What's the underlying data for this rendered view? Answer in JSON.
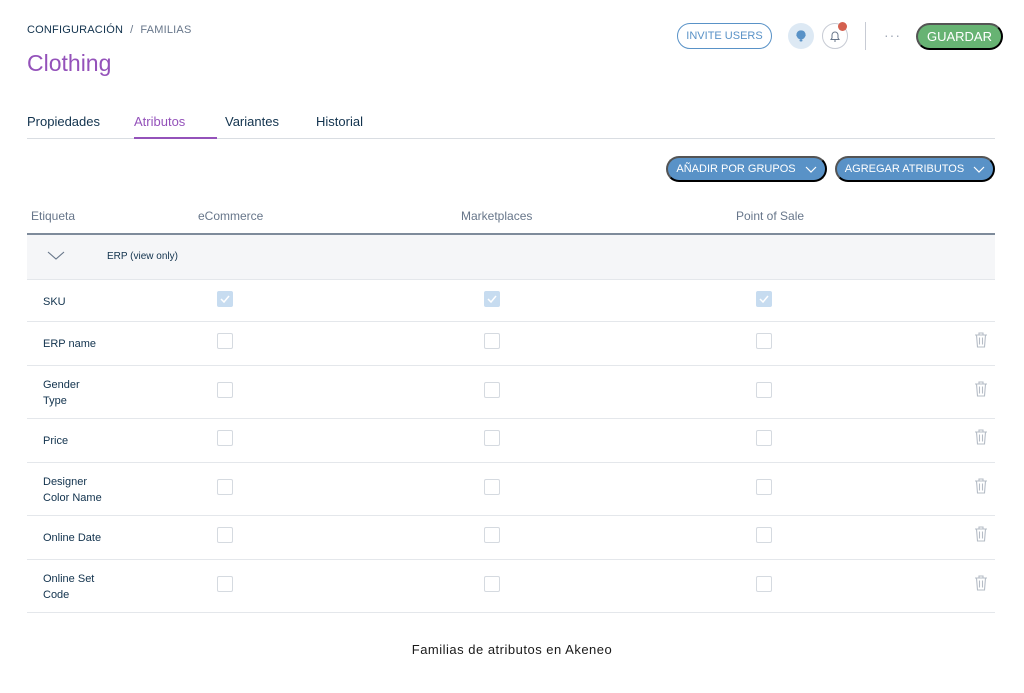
{
  "breadcrumb": {
    "level1": "CONFIGURACIÓN",
    "separator": "/",
    "level2": "FAMILIAS"
  },
  "page_title": "Clothing",
  "header": {
    "invite_label": "INVITE USERS",
    "save_label": "GUARDAR",
    "more_label": "···",
    "icons": {
      "help": "help-headset-icon",
      "notifications": "bell-icon",
      "more": "more-dots-icon"
    },
    "colors": {
      "accent": "#9452ba",
      "primary": "#5992c7",
      "save": "#67b373",
      "notification_dot": "#d4604f"
    }
  },
  "tabs": [
    {
      "label": "Propiedades",
      "active": false
    },
    {
      "label": "Atributos",
      "active": true
    },
    {
      "label": "Variantes",
      "active": false
    },
    {
      "label": "Historial",
      "active": false
    }
  ],
  "actions": {
    "add_by_groups": "AÑADIR POR GRUPOS",
    "add_attributes": "AGREGAR ATRIBUTOS"
  },
  "table": {
    "columns": [
      "Etiqueta",
      "eCommerce",
      "Marketplaces",
      "Point of Sale"
    ],
    "group": {
      "label": "ERP (view only)"
    },
    "rows": [
      {
        "label_lines": [
          "SKU"
        ],
        "checks": [
          true,
          true,
          true
        ],
        "removable": false
      },
      {
        "label_lines": [
          "ERP name"
        ],
        "checks": [
          false,
          false,
          false
        ],
        "removable": true
      },
      {
        "label_lines": [
          "Gender",
          "Type"
        ],
        "checks": [
          false,
          false,
          false
        ],
        "removable": true
      },
      {
        "label_lines": [
          "Price"
        ],
        "checks": [
          false,
          false,
          false
        ],
        "removable": true
      },
      {
        "label_lines": [
          "Designer",
          "Color Name"
        ],
        "checks": [
          false,
          false,
          false
        ],
        "removable": true
      },
      {
        "label_lines": [
          "Online Date"
        ],
        "checks": [
          false,
          false,
          false
        ],
        "removable": true
      },
      {
        "label_lines": [
          "Online Set",
          "Code"
        ],
        "checks": [
          false,
          false,
          false
        ],
        "removable": true
      }
    ]
  },
  "caption": "Familias de atributos en Akeneo"
}
